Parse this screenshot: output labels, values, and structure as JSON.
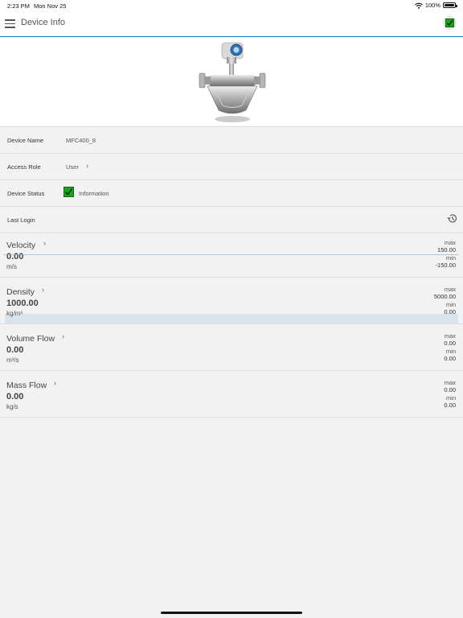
{
  "status_bar": {
    "time": "2:23 PM",
    "date": "Mon Nov 25",
    "battery": "100%"
  },
  "nav": {
    "title": "Device Info",
    "status_icon": "check-icon"
  },
  "colors": {
    "accent": "#2a7ab8",
    "status_ok": "#1aa51a"
  },
  "device": {
    "name_label": "Device Name",
    "name_value": "MFC400_8",
    "role_label": "Access Role",
    "role_value": "User",
    "status_label": "Device Status",
    "status_value": "Information",
    "login_label": "Last Login",
    "login_icon": "history-icon"
  },
  "measurements": [
    {
      "name": "Velocity",
      "value": "0.00",
      "unit": "m/s",
      "max_label": "max",
      "max": "150.00",
      "min_label": "min",
      "min": "-150.00"
    },
    {
      "name": "Density",
      "value": "1000.00",
      "unit": "kg/m³",
      "max_label": "max",
      "max": "5000.00",
      "min_label": "min",
      "min": "0.00"
    },
    {
      "name": "Volume Flow",
      "value": "0.00",
      "unit": "m³/s",
      "max_label": "max",
      "max": "0.00",
      "min_label": "min",
      "min": "0.00"
    },
    {
      "name": "Mass Flow",
      "value": "0.00",
      "unit": "kg/s",
      "max_label": "max",
      "max": "0.00",
      "min_label": "min",
      "min": "0.00"
    }
  ]
}
